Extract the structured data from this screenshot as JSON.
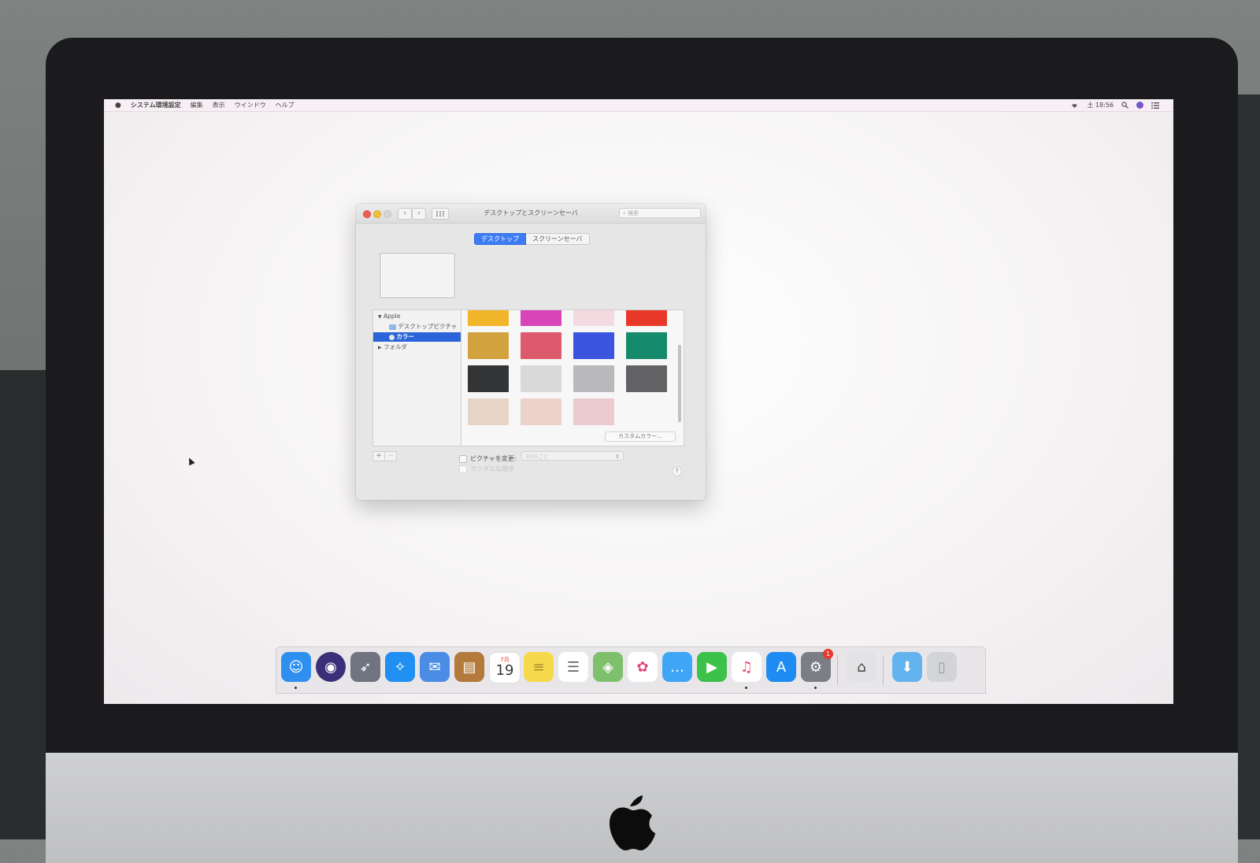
{
  "menubar": {
    "app_name": "システム環境設定",
    "items": [
      "編集",
      "表示",
      "ウインドウ",
      "ヘルプ"
    ],
    "clock": "土 18:56"
  },
  "window": {
    "title": "デスクトップとスクリーンセーバ",
    "search_placeholder": "検索",
    "tabs": [
      "デスクトップ",
      "スクリーンセーバ"
    ],
    "source_list": [
      {
        "label": "Apple",
        "expanded": true
      },
      {
        "label": "デスクトップピクチャ"
      },
      {
        "label": "カラー",
        "selected": true
      },
      {
        "label": "フォルダ",
        "expanded": false
      }
    ],
    "swatches": [
      "#f1b52a",
      "#d845b8",
      "#f3d9e0",
      "#e8382a",
      "#d2a23e",
      "#dd5a6c",
      "#3b55e0",
      "#158a6c",
      "#333435",
      "#d9d9d9",
      "#b9b9bb",
      "#626265",
      "#e7d6c8",
      "#ecd2c8",
      "#ebcbce"
    ],
    "custom_color_label": "カスタムカラー...",
    "plus_label": "+",
    "minus_label": "−",
    "change_picture_label": "ピクチャを変更:",
    "interval_value": "30分ごと",
    "random_label": "ランダムな順序",
    "help_label": "?"
  },
  "dock": {
    "calendar": {
      "month": "7月",
      "day": "19"
    },
    "settings_badge": "1",
    "icons": [
      {
        "name": "finder-icon",
        "color": "#2f8ff0"
      },
      {
        "name": "siri-icon",
        "color": "#3b2f7a"
      },
      {
        "name": "launchpad-icon",
        "color": "#6f7480"
      },
      {
        "name": "safari-icon",
        "color": "#1f8ff2"
      },
      {
        "name": "mail-icon",
        "color": "#4b8de6"
      },
      {
        "name": "contacts-icon",
        "color": "#b47a3c"
      },
      {
        "name": "calendar-icon",
        "color": "#ffffff"
      },
      {
        "name": "notes-icon",
        "color": "#f6d94a"
      },
      {
        "name": "reminders-icon",
        "color": "#ffffff"
      },
      {
        "name": "maps-icon",
        "color": "#7ec06c"
      },
      {
        "name": "photos-icon",
        "color": "#ffffff"
      },
      {
        "name": "messages-icon",
        "color": "#3fa6f5"
      },
      {
        "name": "facetime-icon",
        "color": "#3cc24a"
      },
      {
        "name": "itunes-icon",
        "color": "#ffffff"
      },
      {
        "name": "appstore-icon",
        "color": "#1e8cf2"
      },
      {
        "name": "system-preferences-icon",
        "color": "#7b7e84"
      },
      {
        "name": "utility-icon",
        "color": "#e3e3e6"
      },
      {
        "name": "downloads-folder-icon",
        "color": "#63b3ee"
      },
      {
        "name": "trash-icon",
        "color": "#d3d4d8"
      }
    ]
  }
}
